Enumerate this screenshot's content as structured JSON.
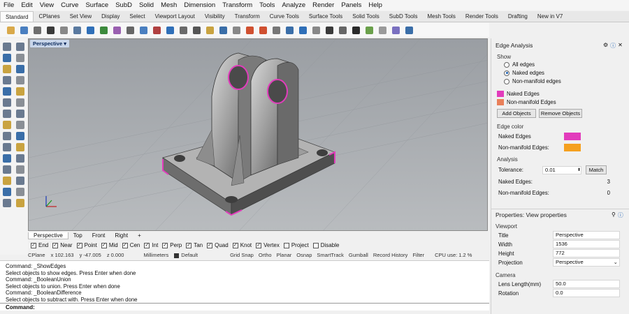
{
  "menu": [
    "File",
    "Edit",
    "View",
    "Curve",
    "Surface",
    "SubD",
    "Solid",
    "Mesh",
    "Dimension",
    "Transform",
    "Tools",
    "Analyze",
    "Render",
    "Panels",
    "Help"
  ],
  "tabs": [
    "Standard",
    "CPlanes",
    "Set View",
    "Display",
    "Select",
    "Viewport Layout",
    "Visibility",
    "Transform",
    "Curve Tools",
    "Surface Tools",
    "Solid Tools",
    "SubD Tools",
    "Mesh Tools",
    "Render Tools",
    "Drafting",
    "New in V7"
  ],
  "viewport": {
    "title": "Perspective"
  },
  "viewport_tabs": [
    "Perspective",
    "Top",
    "Front",
    "Right",
    "+"
  ],
  "osnap": [
    {
      "label": "End",
      "checked": true
    },
    {
      "label": "Near",
      "checked": true
    },
    {
      "label": "Point",
      "checked": true
    },
    {
      "label": "Mid",
      "checked": true
    },
    {
      "label": "Cen",
      "checked": true
    },
    {
      "label": "Int",
      "checked": true
    },
    {
      "label": "Perp",
      "checked": true
    },
    {
      "label": "Tan",
      "checked": true
    },
    {
      "label": "Quad",
      "checked": true
    },
    {
      "label": "Knot",
      "checked": true
    },
    {
      "label": "Vertex",
      "checked": true
    },
    {
      "label": "Project",
      "checked": false
    },
    {
      "label": "Disable",
      "checked": false
    }
  ],
  "status": {
    "cplane": "CPlane",
    "x": "x 102.163",
    "y": "y -47.005",
    "z": "z 0.000",
    "units": "Millimeters",
    "layer": "Default",
    "toggles": [
      "Grid Snap",
      "Ortho",
      "Planar",
      "Osnap",
      "SmartTrack",
      "Gumball",
      "Record History",
      "Filter"
    ],
    "cpu": "CPU use: 1.2 %"
  },
  "command_history": [
    "Command: _ShowEdges",
    "Select objects to show edges. Press Enter when done",
    "Command: _BooleanUnion",
    "Select objects to union. Press Enter when done",
    "Command: _BooleanDifference",
    "Select objects to subtract with. Press Enter when done"
  ],
  "command_prompt": "Command:",
  "edge_panel": {
    "title": "Edge Analysis",
    "show_label": "Show",
    "options": [
      "All edges",
      "Naked edges",
      "Non-manifold edges"
    ],
    "selected": 1,
    "legend": [
      {
        "label": "Naked Edges",
        "color": "#e23cbc"
      },
      {
        "label": "Non-manifold Edges",
        "color": "#e9805a"
      }
    ],
    "add_button": "Add Objects",
    "remove_button": "Remove Objects",
    "edge_color_label": "Edge color",
    "colors": [
      {
        "label": "Naked Edges",
        "color": "#e23cbc"
      },
      {
        "label": "Non-manifold Edges:",
        "color": "#f5a020"
      }
    ],
    "analysis_label": "Analysis",
    "tolerance_label": "Tolerance:",
    "tolerance_value": "0.01",
    "match_button": "Match",
    "naked_count_label": "Naked Edges:",
    "naked_count": "3",
    "nonmanifold_count_label": "Non-manifold Edges:",
    "nonmanifold_count": "0"
  },
  "properties": {
    "title": "Properties: View properties",
    "viewport_label": "Viewport",
    "rows": [
      {
        "key": "Title",
        "value": "Perspective"
      },
      {
        "key": "Width",
        "value": "1536"
      },
      {
        "key": "Height",
        "value": "772"
      },
      {
        "key": "Projection",
        "value": "Perspective"
      }
    ],
    "camera_label": "Camera",
    "camera_rows": [
      {
        "key": "Lens Length(mm)",
        "value": "50.0"
      },
      {
        "key": "Rotation",
        "value": "0.0"
      }
    ]
  }
}
